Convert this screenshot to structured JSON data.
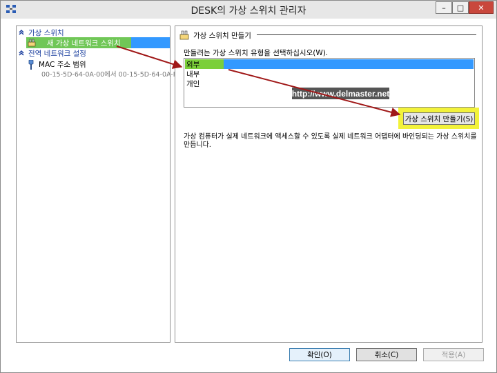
{
  "window": {
    "title": "DESK의 가상 스위치 관리자",
    "controls": {
      "minimize": "–",
      "maximize": "□",
      "close": "✕"
    }
  },
  "left_pane": {
    "section1": {
      "label": "가상 스위치",
      "item": "새 가상 네트워크 스위치"
    },
    "section2": {
      "label": "전역 네트워크 설정",
      "item": "MAC 주소 범위",
      "range": "00-15-5D-64-0A-00에서 00-15-5D-64-0A-FF"
    }
  },
  "right_pane": {
    "group_title": "가상 스위치 만들기",
    "prompt": "만들려는 가상 스위치 유형을 선택하십시오(W).",
    "switch_types": [
      "외부",
      "내부",
      "개인"
    ],
    "selected_index": 0,
    "create_button": "가상 스위치 만들기(S)",
    "description": "가상 컴퓨터가 실제 네트워크에 액세스할 수 있도록 실제 네트워크 어댑터에 바인딩되는 가상 스위치를 만듭니다."
  },
  "watermark": "http://www.delmaster.net",
  "footer": {
    "ok": "확인(O)",
    "cancel": "취소(C)",
    "apply": "적용(A)"
  },
  "colors": {
    "selection": "#3399ff",
    "highlight_green": "#7bcf3a",
    "highlight_yellow": "#f2f23a",
    "arrow": "#a01818",
    "link_blue": "#1a3e9e"
  }
}
